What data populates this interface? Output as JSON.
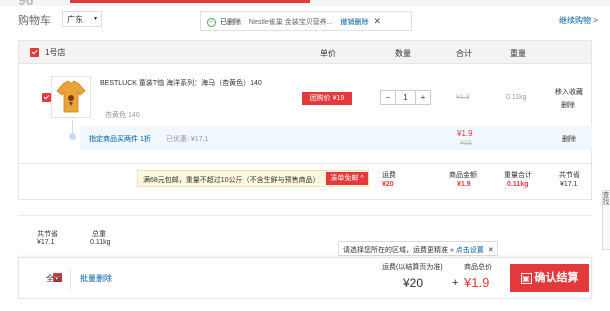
{
  "header": {
    "logo_partial": "96",
    "title": "购物车",
    "region_select": "广东",
    "notice": {
      "deleted_label": "已删除",
      "deleted_item": "Nestle雀巢 金装宝贝营养...",
      "undo_label": "撤销删除"
    },
    "continue_shopping": "继续购物 >"
  },
  "columns": {
    "price": "单价",
    "quantity": "数量",
    "subtotal": "合计",
    "weight": "重量"
  },
  "store": {
    "name": "1号店"
  },
  "item": {
    "name": "BESTLUCK 童装T恤 海洋系列：海马（杏黄色）140",
    "variant": "杏黄色 140",
    "promo_badge": "团购价 ¥19",
    "quantity": "1",
    "minus": "−",
    "plus": "+",
    "original_price": "¥1.9",
    "weight": "0.11kg",
    "actions": [
      "移入收藏",
      "删除"
    ]
  },
  "promo_row": {
    "label": "指定商品买两件 1折",
    "saved_label": "已优惠: ¥17.1",
    "subtotal": "¥1.9",
    "subtotal_original": "¥19",
    "delete": "删除"
  },
  "shipping_bar": {
    "message": "满68元包邮，重量不超过10公斤（不含生鲜与预售商品）",
    "free_shipping_tag": "凑单免邮 ^"
  },
  "store_summary": {
    "shipping_label": "运费",
    "shipping_value": "¥20",
    "amount_label": "商品金额",
    "amount_value": "¥1.9",
    "weight_label": "重量合计",
    "weight_value": "0.11kg",
    "saved_label": "共节省",
    "saved_value": "¥17.1"
  },
  "totals_preview": {
    "saved_label": "共节省",
    "saved_value": "¥17.1",
    "weight_label": "总重",
    "weight_value": "0.11kg"
  },
  "region_tip": {
    "text": "请选择您所在的区域，运费更精准 »",
    "link": "点击设置"
  },
  "bottom_bar": {
    "select_all": "全选",
    "batch_delete": "批量删除",
    "shipping_label": "运费(以结算页为准)",
    "shipping_value": "¥20",
    "plus": "+",
    "total_label": "商品总价",
    "total_value": "¥1.9",
    "checkout": "确认结算"
  },
  "side_tab": "查找"
}
